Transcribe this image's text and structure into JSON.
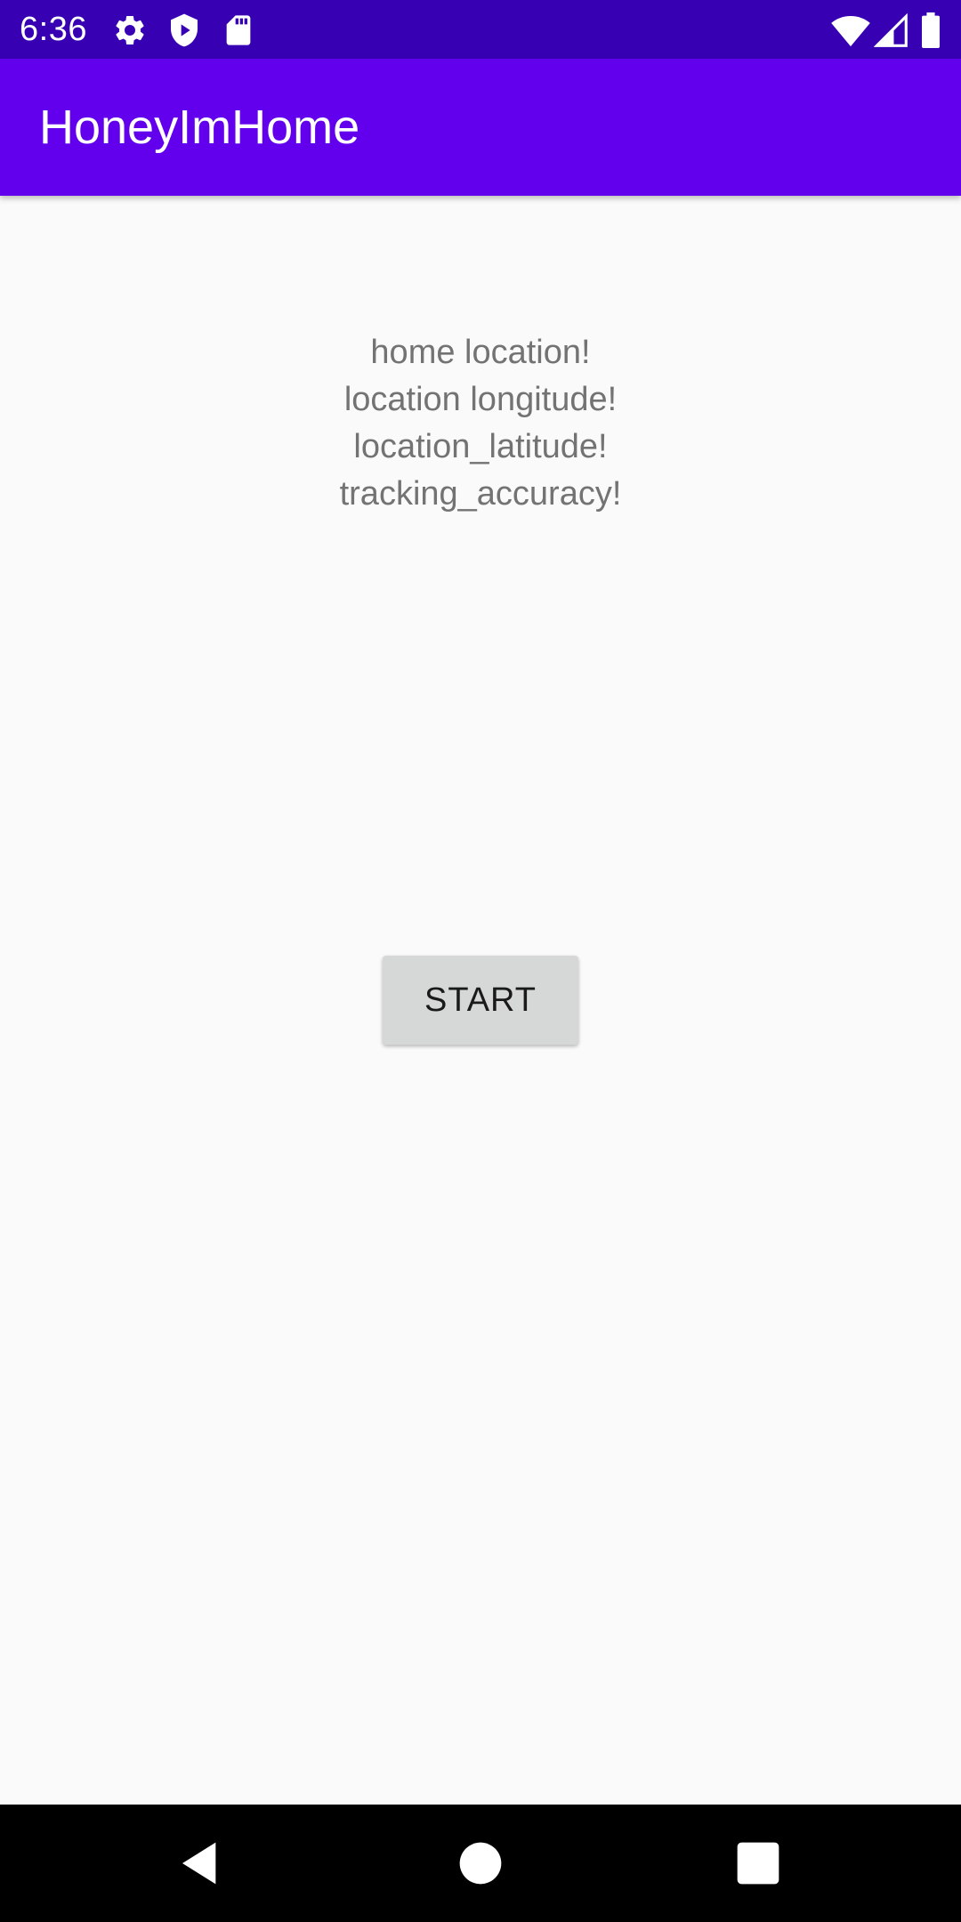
{
  "status_bar": {
    "time": "6:36",
    "left_icons": [
      "gear-icon",
      "shield-play-icon",
      "sd-card-icon"
    ],
    "right_icons": [
      "wifi-icon",
      "cellular-signal-icon",
      "battery-icon"
    ]
  },
  "app_bar": {
    "title": "HoneyImHome",
    "color": "#6200ee"
  },
  "info": {
    "home_location": "home location!",
    "longitude": "location longitude!",
    "latitude": "location_latitude!",
    "accuracy": "tracking_accuracy!"
  },
  "start_button": {
    "label": "START"
  },
  "nav_bar": {
    "buttons": [
      "back-icon",
      "home-icon",
      "recents-icon"
    ]
  },
  "colors": {
    "status_bar": "#3700b3",
    "app_bar": "#6200ee",
    "background": "#fafafa",
    "text_secondary": "#737373",
    "button": "#d6d7d7"
  }
}
